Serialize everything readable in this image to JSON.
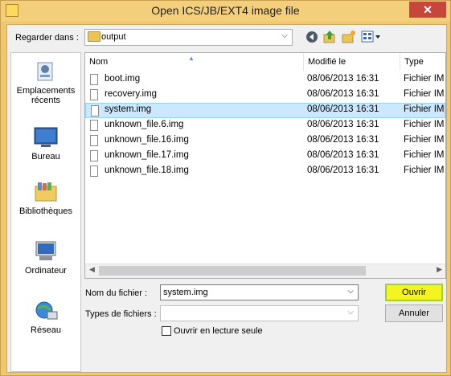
{
  "window": {
    "title": "Open ICS/JB/EXT4 image file",
    "close_glyph": "✕"
  },
  "lookin": {
    "label": "Regarder dans :",
    "value": "output"
  },
  "toolbar": {
    "icons": [
      "back-icon",
      "up-folder-icon",
      "new-folder-icon",
      "view-menu-icon"
    ]
  },
  "places": [
    {
      "label": "Emplacements récents",
      "icon": "recent-places-icon"
    },
    {
      "label": "Bureau",
      "icon": "desktop-icon"
    },
    {
      "label": "Bibliothèques",
      "icon": "libraries-icon"
    },
    {
      "label": "Ordinateur",
      "icon": "computer-icon"
    },
    {
      "label": "Réseau",
      "icon": "network-icon"
    }
  ],
  "columns": {
    "name": "Nom",
    "modified": "Modifié le",
    "type": "Type"
  },
  "files": [
    {
      "name": "boot.img",
      "modified": "08/06/2013 16:31",
      "type": "Fichier IM"
    },
    {
      "name": "recovery.img",
      "modified": "08/06/2013 16:31",
      "type": "Fichier IM"
    },
    {
      "name": "system.img",
      "modified": "08/06/2013 16:31",
      "type": "Fichier IM",
      "selected": true
    },
    {
      "name": "unknown_file.6.img",
      "modified": "08/06/2013 16:31",
      "type": "Fichier IM"
    },
    {
      "name": "unknown_file.16.img",
      "modified": "08/06/2013 16:31",
      "type": "Fichier IM"
    },
    {
      "name": "unknown_file.17.img",
      "modified": "08/06/2013 16:31",
      "type": "Fichier IM"
    },
    {
      "name": "unknown_file.18.img",
      "modified": "08/06/2013 16:31",
      "type": "Fichier IM"
    }
  ],
  "filename": {
    "label": "Nom du fichier :",
    "value": "system.img"
  },
  "filetypes": {
    "label": "Types de fichiers :",
    "value": ""
  },
  "readonly": {
    "label": "Ouvrir en lecture seule",
    "checked": false
  },
  "buttons": {
    "open": "Ouvrir",
    "cancel": "Annuler"
  },
  "colors": {
    "frame": "#f0c870",
    "selection": "#cce8ff",
    "open_highlight": "#f4f421"
  }
}
